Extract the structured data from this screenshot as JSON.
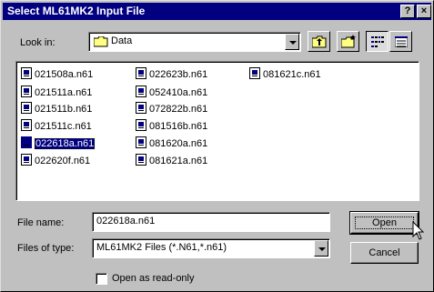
{
  "window": {
    "title": "Select ML61MK2 Input File",
    "help_glyph": "?",
    "close_glyph": "×"
  },
  "look_in": {
    "label": "Look in:",
    "value": "Data"
  },
  "files": [
    "021508a.n61",
    "021511a.n61",
    "021511b.n61",
    "021511c.n61",
    "022618a.n61",
    "022620f.n61",
    "022623b.n61",
    "052410a.n61",
    "072822b.n61",
    "081516b.n61",
    "081620a.n61",
    "081621a.n61",
    "081621c.n61"
  ],
  "selected_file": "022618a.n61",
  "file_name": {
    "label": "File name:",
    "value": "022618a.n61"
  },
  "file_type": {
    "label": "Files of type:",
    "value": "ML61MK2 Files (*.N61,*.n61)"
  },
  "buttons": {
    "open": "Open",
    "cancel": "Cancel"
  },
  "read_only": {
    "label": "Open as read-only",
    "checked": false
  },
  "colors": {
    "titlebar": "#000080",
    "face": "#c0c0c0",
    "selection": "#000080"
  }
}
